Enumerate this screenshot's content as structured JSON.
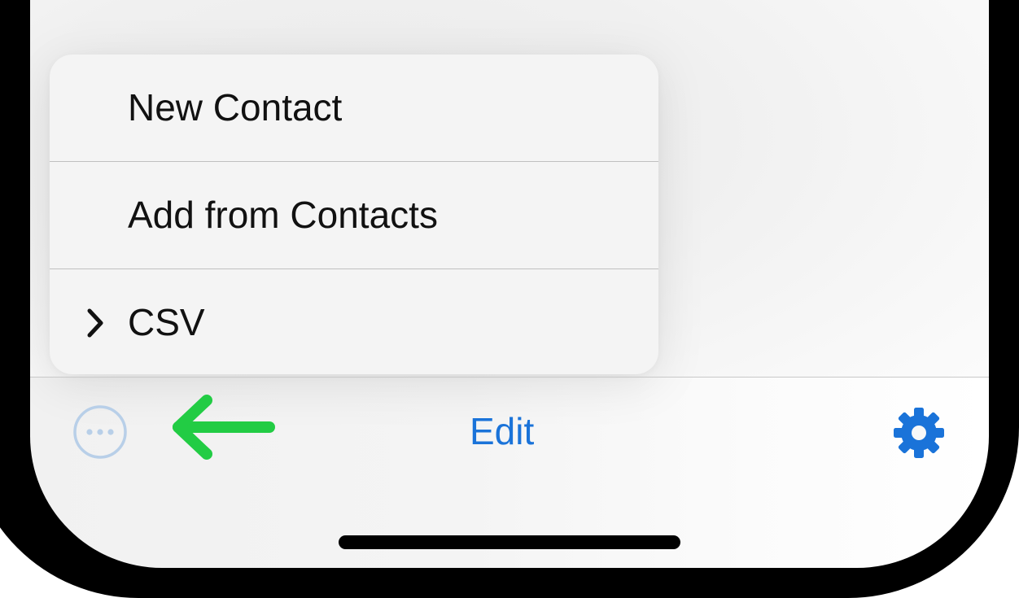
{
  "menu": {
    "items": [
      {
        "label": "New Contact",
        "has_submenu": false
      },
      {
        "label": "Add from Contacts",
        "has_submenu": false
      },
      {
        "label": "CSV",
        "has_submenu": true
      }
    ]
  },
  "toolbar": {
    "edit_label": "Edit",
    "more_icon": "ellipsis-circle-icon",
    "settings_icon": "gear-icon"
  },
  "annotation": {
    "icon": "left-arrow-icon",
    "color": "#22cc44"
  },
  "colors": {
    "accent": "#1a73d9",
    "more_button": "#b8cfe8",
    "annotation_arrow": "#22cc44"
  }
}
